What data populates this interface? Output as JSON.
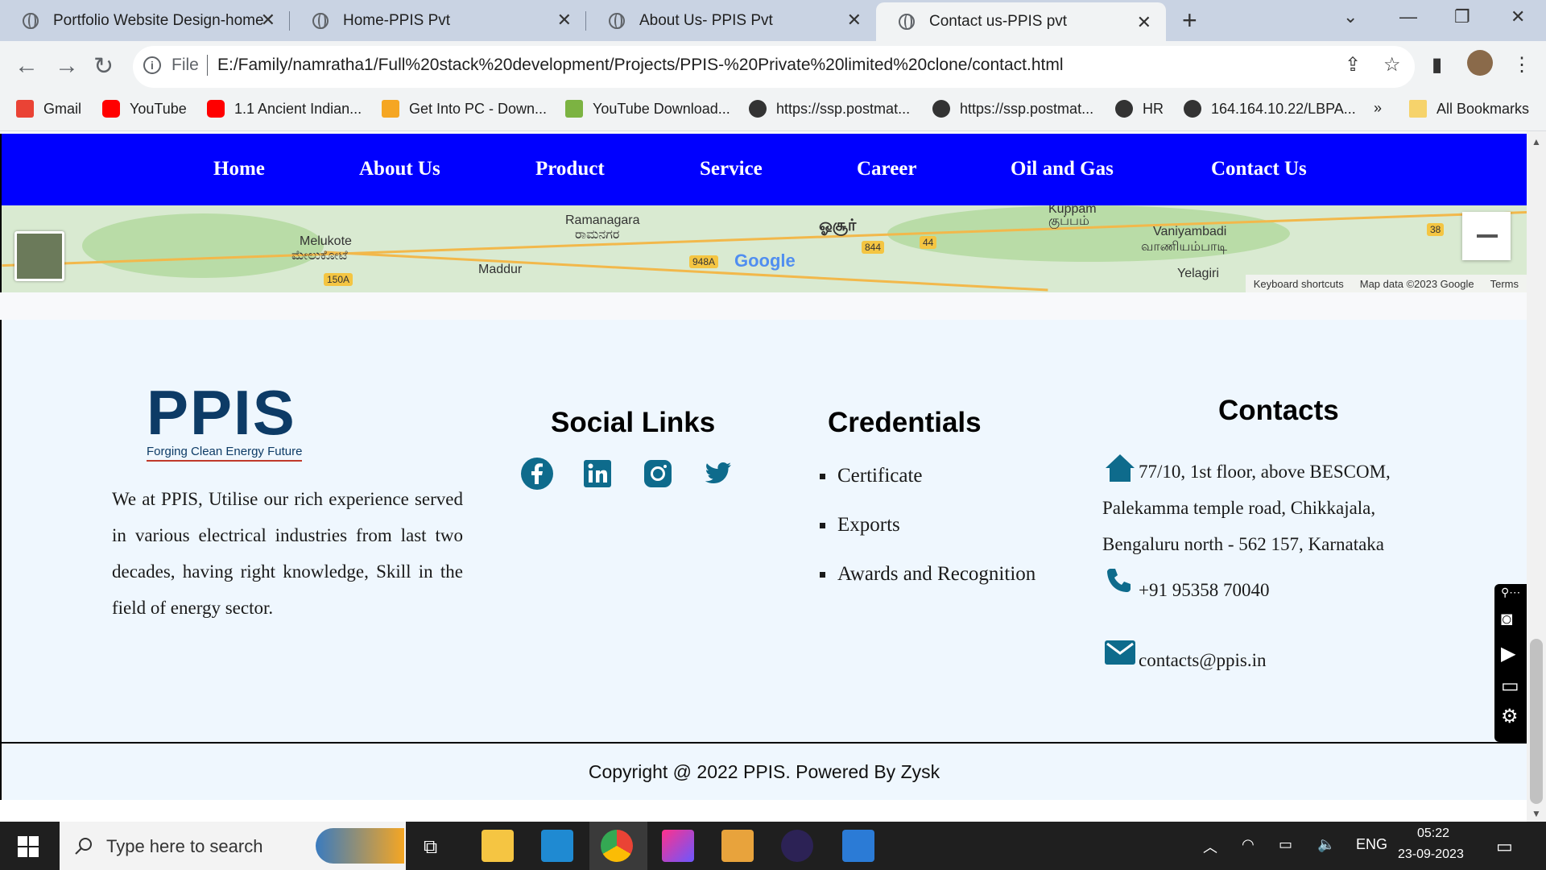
{
  "browser": {
    "tabs": [
      {
        "title": "Portfolio Website Design-home"
      },
      {
        "title": "Home-PPIS Pvt"
      },
      {
        "title": "About Us- PPIS Pvt"
      },
      {
        "title": "Contact us-PPIS pvt"
      }
    ],
    "address": {
      "scheme_label": "File",
      "url": "E:/Family/namratha1/Full%20stack%20development/Projects/PPIS-%20Private%20limited%20clone/contact.html"
    },
    "bookmarks": [
      {
        "label": "Gmail"
      },
      {
        "label": "YouTube"
      },
      {
        "label": "1.1 Ancient Indian..."
      },
      {
        "label": "Get Into PC - Down..."
      },
      {
        "label": "YouTube Download..."
      },
      {
        "label": "https://ssp.postmat..."
      },
      {
        "label": "https://ssp.postmat..."
      },
      {
        "label": "HR"
      },
      {
        "label": "164.164.10.22/LBPA..."
      }
    ],
    "bookmarks_overflow": "»",
    "all_bookmarks": "All Bookmarks"
  },
  "nav": {
    "items": [
      "Home",
      "About Us",
      "Product",
      "Service",
      "Career",
      "Oil and Gas",
      "Contact Us"
    ]
  },
  "map": {
    "labels": [
      "Melukote",
      "ಮೇಲುಕೋಟೆ",
      "Ramanagara",
      "ರಾಮನಗರ",
      "ஓசூர்",
      "Maddur",
      "Vaniyambadi",
      "வாணியம்பாடி",
      "Yelagiri",
      "Kuppam",
      "குப்பம்"
    ],
    "shields": [
      "150A",
      "948A",
      "844",
      "44",
      "38"
    ],
    "google": "Google",
    "attribution": [
      "Keyboard shortcuts",
      "Map data ©2023 Google",
      "Terms"
    ]
  },
  "footer": {
    "logo_text": "PPIS",
    "logo_tagline": "Forging Clean Energy Future",
    "about": "We at PPIS, Utilise our rich experience served in various electrical industries from last two decades, having right knowledge, Skill in the field of energy sector.",
    "social_heading": "Social Links",
    "social_icons": [
      "facebook-icon",
      "linkedin-icon",
      "instagram-icon",
      "twitter-icon"
    ],
    "credentials_heading": "Credentials",
    "credentials": [
      "Certificate",
      "Exports",
      "Awards and Recognition"
    ],
    "contacts_heading": "Contacts",
    "address_lines": [
      "77/10, 1st floor, above BESCOM,",
      "Palekamma temple road, Chikkajala,",
      "Bengaluru north - 562 157, Karnataka"
    ],
    "phone": "+91 95358 70040",
    "email": "contacts@ppis.in",
    "copyright": "Copyright @ 2022 PPIS. Powered By Zysk"
  },
  "taskbar": {
    "search_placeholder": "Type here to search",
    "language": "ENG",
    "time": "05:22",
    "date": "23-09-2023"
  }
}
